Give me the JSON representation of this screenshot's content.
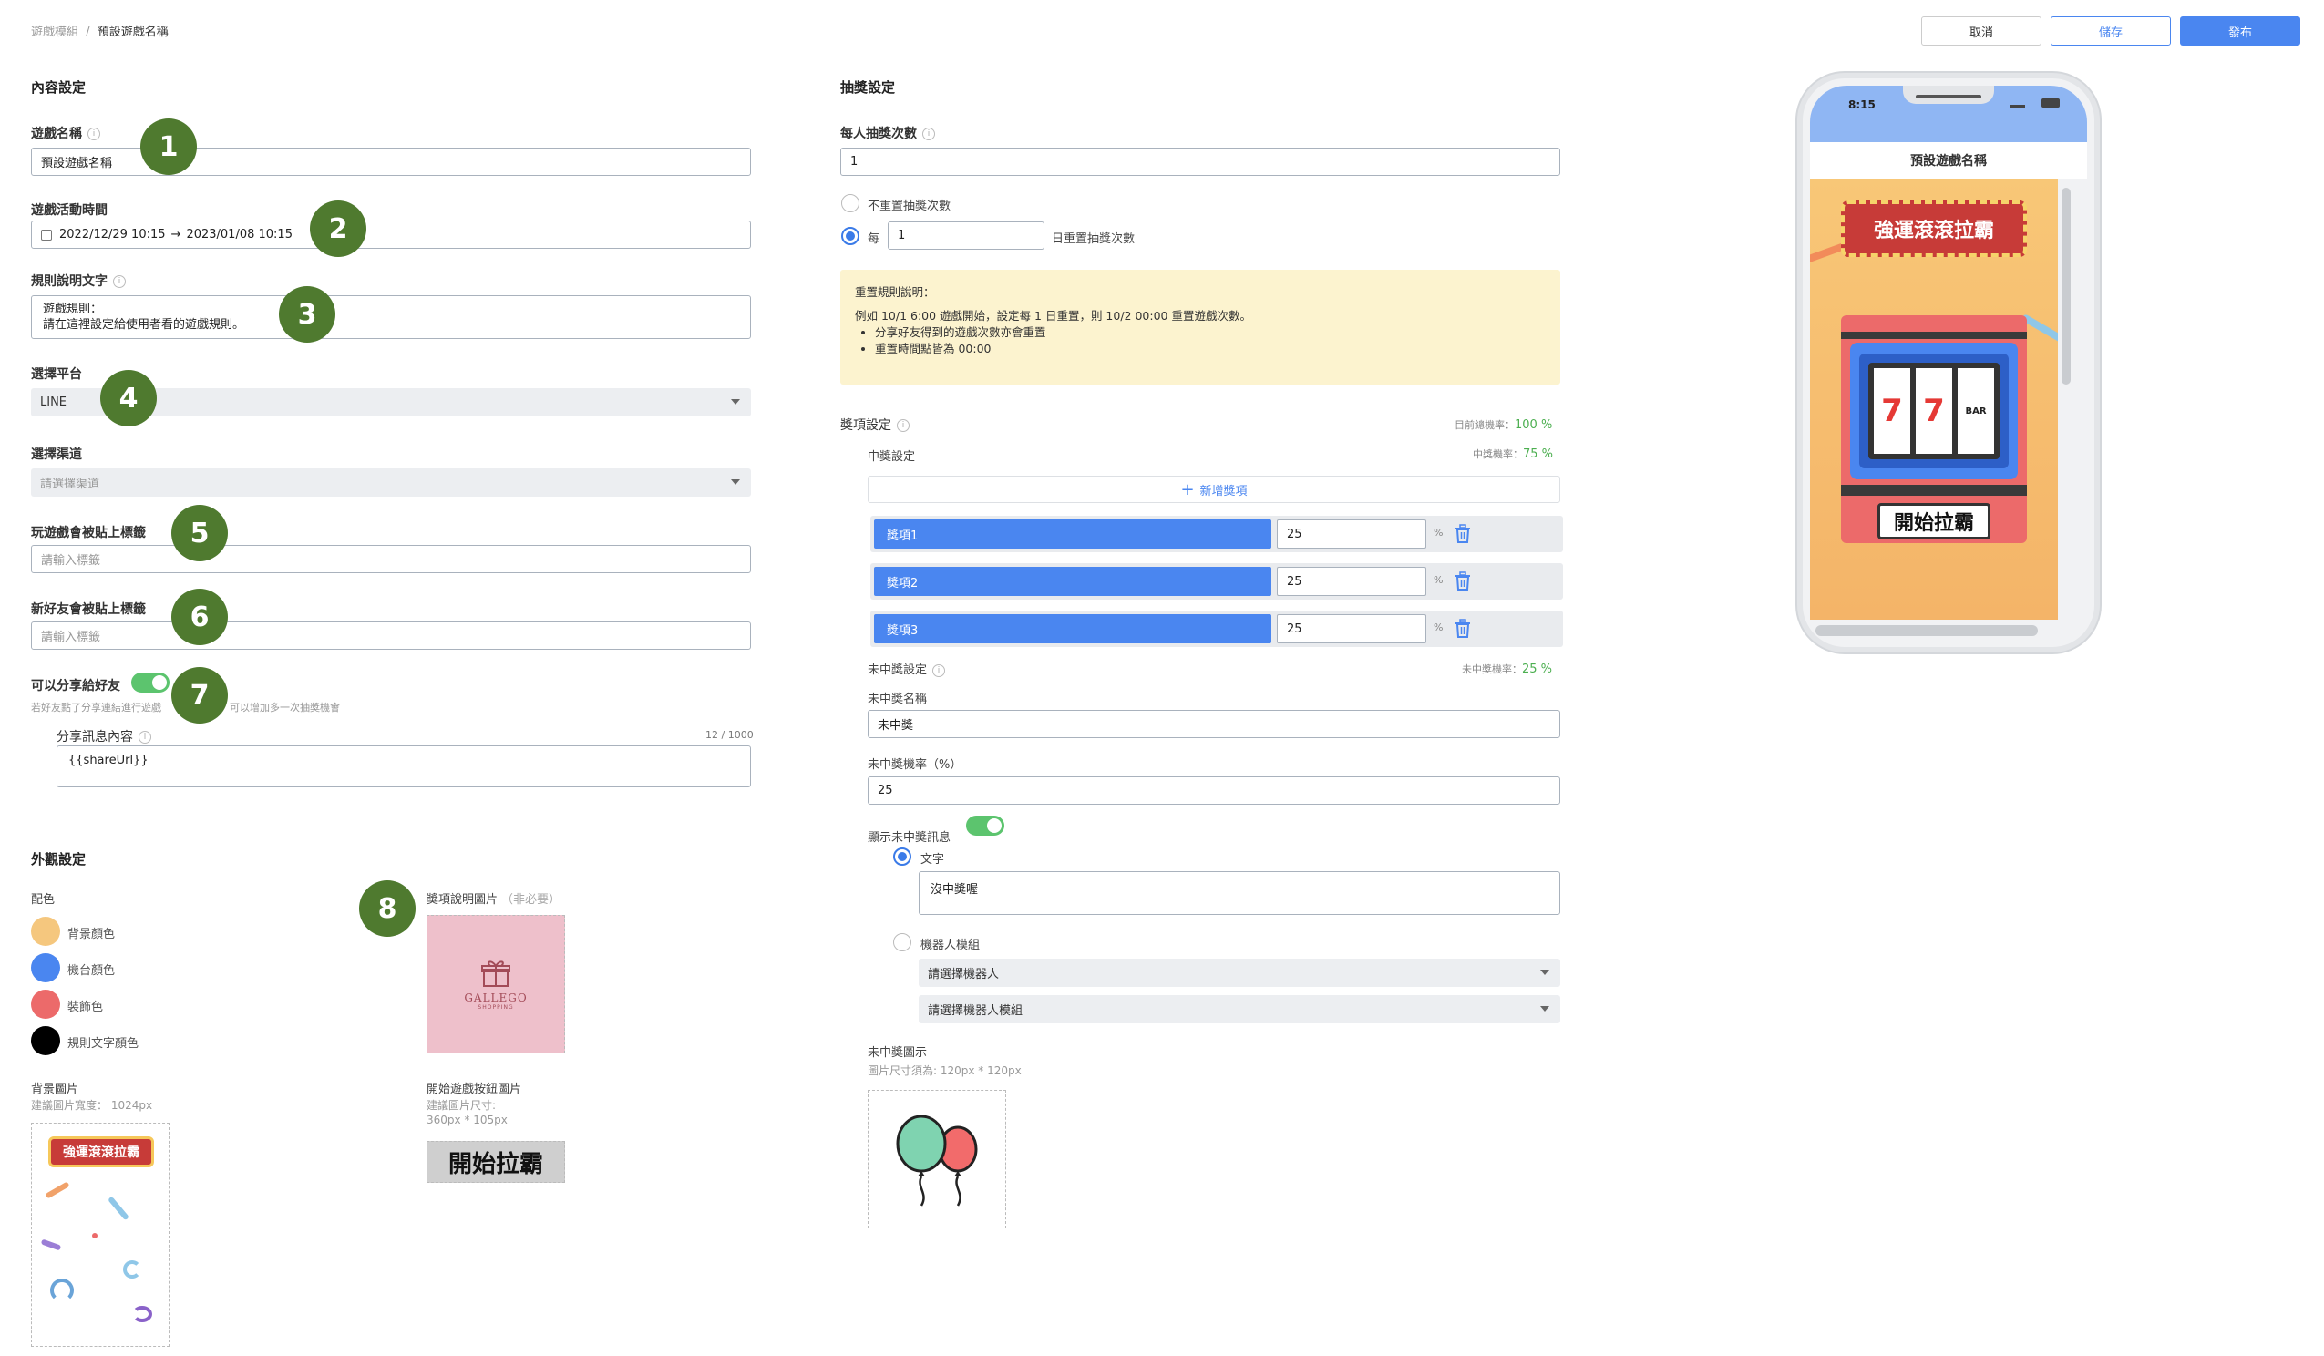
{
  "breadcrumb": {
    "parent": "遊戲模組",
    "current": "預設遊戲名稱"
  },
  "header": {
    "cancel": "取消",
    "save": "儲存",
    "publish": "發布"
  },
  "content": {
    "title": "內容設定",
    "game_name": {
      "label": "遊戲名稱",
      "value": "預設遊戲名稱"
    },
    "game_period": {
      "label": "遊戲活動時間",
      "start": "2022/12/29 10:15",
      "arrow": "→",
      "end": "2023/01/08 10:15"
    },
    "rules": {
      "label": "規則說明文字",
      "line1": "遊戲規則：",
      "line2": "請在這裡設定給使用者看的遊戲規則。"
    },
    "platform": {
      "label": "選擇平台",
      "value": "LINE"
    },
    "channel": {
      "label": "選擇渠道",
      "placeholder": "請選擇渠道"
    },
    "play_tag": {
      "label": "玩遊戲會被貼上標籤",
      "placeholder": "請輸入標籤"
    },
    "friend_tag": {
      "label": "新好友會被貼上標籤",
      "placeholder": "請輸入標籤"
    },
    "share": {
      "label": "可以分享給好友",
      "hint_left": "若好友點了分享連結進行遊戲",
      "hint_right": "可以增加多一次抽獎機會",
      "msg_label": "分享訊息內容",
      "msg_count": "12 / 1000",
      "msg_value": "{{shareUrl}}"
    }
  },
  "appearance": {
    "title": "外觀設定",
    "palette_label": "配色",
    "colors": [
      {
        "name": "背景顏色",
        "hex": "#f5c77e"
      },
      {
        "name": "機台顏色",
        "hex": "#4a86f0"
      },
      {
        "name": "裝飾色",
        "hex": "#ec6a6a"
      },
      {
        "name": "規則文字顏色",
        "hex": "#000000"
      }
    ],
    "bg_image": {
      "label": "背景圖片",
      "hint": "建議圖片寬度： 1024px",
      "banner": "強運滾滾拉霸"
    },
    "prize_image": {
      "label": "獎項說明圖片",
      "optional": "（非必要）",
      "brand": "GALLEGO",
      "brand_sub": "SHOPPING"
    },
    "start_button": {
      "label": "開始遊戲按鈕圖片",
      "hint1": "建議圖片尺寸:",
      "hint2": "360px * 105px",
      "text": "開始拉霸"
    }
  },
  "lottery": {
    "title": "抽獎設定",
    "per_person": {
      "label": "每人抽獎次數",
      "value": "1"
    },
    "no_reset": "不重置抽獎次數",
    "every_prefix": "每",
    "every_value": "1",
    "every_suffix": "日重置抽獎次數",
    "reset_note": {
      "title": "重置規則說明：",
      "line": "例如 10/1 6:00 遊戲開始，設定每 1 日重置，則 10/2 00:00 重置遊戲次數。",
      "bullet1": "分享好友得到的遊戲次數亦會重置",
      "bullet2": "重置時間點皆為 00:00"
    },
    "prize_settings": {
      "label": "獎項設定",
      "total_label": "目前總機率：",
      "total_value": "100 %"
    },
    "win": {
      "label": "中獎設定",
      "rate_label": "中獎機率：",
      "rate_value": "75 %",
      "add": "新增獎項",
      "items": [
        {
          "name": "獎項1",
          "value": "25",
          "unit": "%"
        },
        {
          "name": "獎項2",
          "value": "25",
          "unit": "%"
        },
        {
          "name": "獎項3",
          "value": "25",
          "unit": "%"
        }
      ]
    },
    "lose": {
      "label": "未中獎設定",
      "rate_label": "未中獎機率：",
      "rate_value": "25 %",
      "name_label": "未中獎名稱",
      "name_value": "未中獎",
      "prob_label": "未中獎機率（%）",
      "prob_value": "25",
      "show_msg": "顯示未中獎訊息",
      "text_option": "文字",
      "text_value": "沒中獎喔",
      "bot_option": "機器人模組",
      "bot_select": "請選擇機器人",
      "bot_module_select": "請選擇機器人模組",
      "icon_label": "未中獎圖示",
      "icon_hint": "圖片尺寸須為: 120px * 120px"
    }
  },
  "preview": {
    "time": "8:15",
    "title": "預設遊戲名稱",
    "banner": "強運滾滾拉霸",
    "start": "開始拉霸",
    "reels": [
      "7",
      "7",
      "BAR"
    ]
  },
  "badges": [
    "1",
    "2",
    "3",
    "4",
    "5",
    "6",
    "7",
    "8"
  ]
}
